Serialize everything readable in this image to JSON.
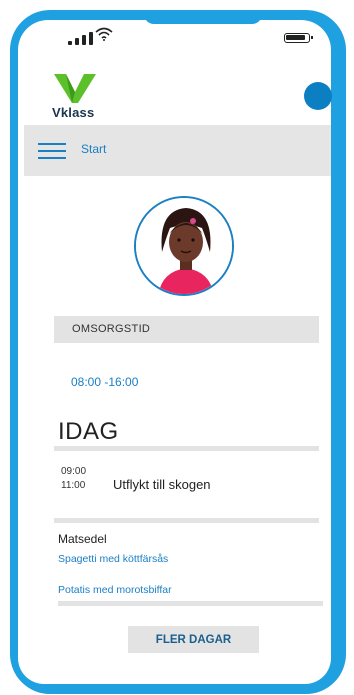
{
  "header": {
    "logo_text": "Vklass"
  },
  "nav": {
    "label": "Start"
  },
  "care_time": {
    "label": "OMSORGSTID",
    "time": "08:00 -16:00"
  },
  "today": {
    "title": "IDAG",
    "event": {
      "start": "09:00",
      "end": "11:00",
      "title": "Utflykt till skogen"
    }
  },
  "menu": {
    "title": "Matsedel",
    "items": [
      "Spagetti med köttfärsås",
      "Potatis med morotsbiffar"
    ]
  },
  "more_button": {
    "label": "FLER DAGAR"
  },
  "colors": {
    "frame": "#1fa0e0",
    "accent": "#1a7fc4",
    "logo_green": "#5cc02a",
    "panel_gray": "#e3e3e3"
  }
}
